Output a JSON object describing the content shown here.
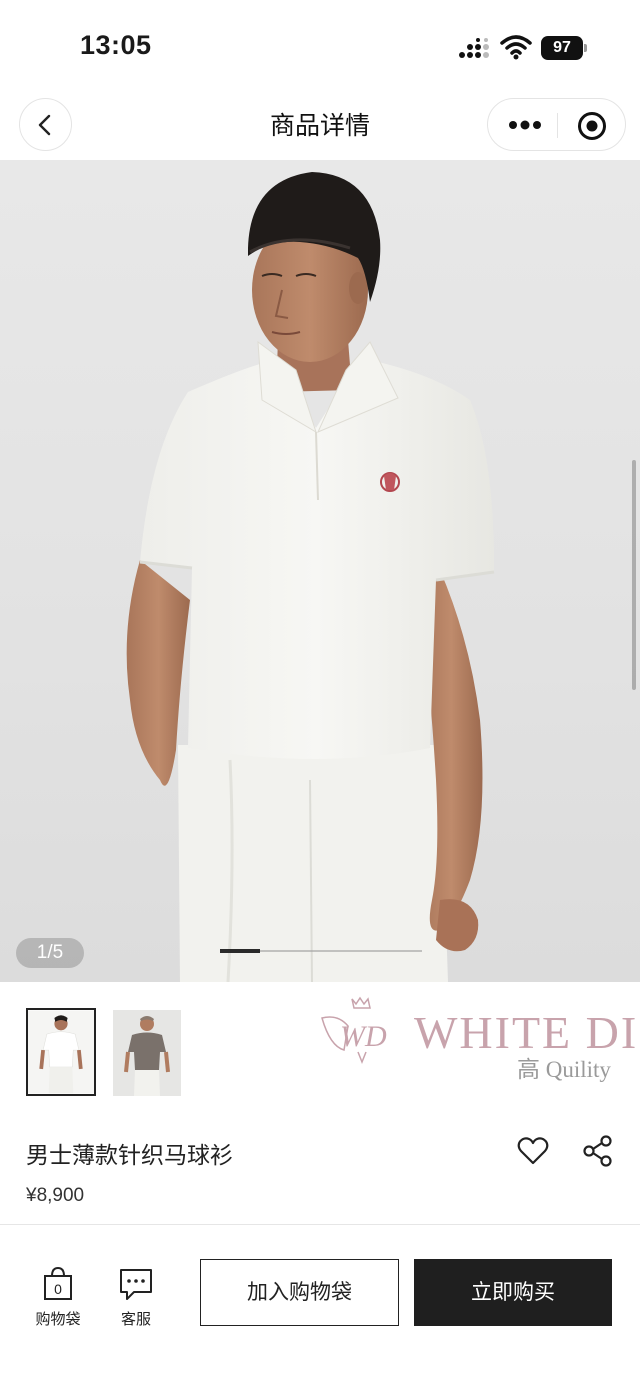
{
  "status_bar": {
    "time": "13:05",
    "battery": "97"
  },
  "nav": {
    "title": "商品详情"
  },
  "gallery": {
    "page_indicator": "1/5",
    "current": 1,
    "total": 5,
    "progress": 0.2
  },
  "watermark": {
    "text": "WHITE DI",
    "subtitle": "高 Quility"
  },
  "product": {
    "title": "男士薄款针织马球衫",
    "price": "¥8,900"
  },
  "bottom_bar": {
    "bag_label": "购物袋",
    "bag_count": "0",
    "service_label": "客服",
    "add_to_bag_label": "加入购物袋",
    "buy_now_label": "立即购买"
  },
  "colors": {
    "primary": "#1f1f1f",
    "watermark": "#c8a3ac",
    "background": "#ffffff"
  },
  "icons": [
    "signal-icon",
    "wifi-icon",
    "battery-icon",
    "back-arrow-icon",
    "more-dots-icon",
    "close-target-icon",
    "heart-icon",
    "share-icon",
    "shopping-bag-icon",
    "chat-icon"
  ]
}
